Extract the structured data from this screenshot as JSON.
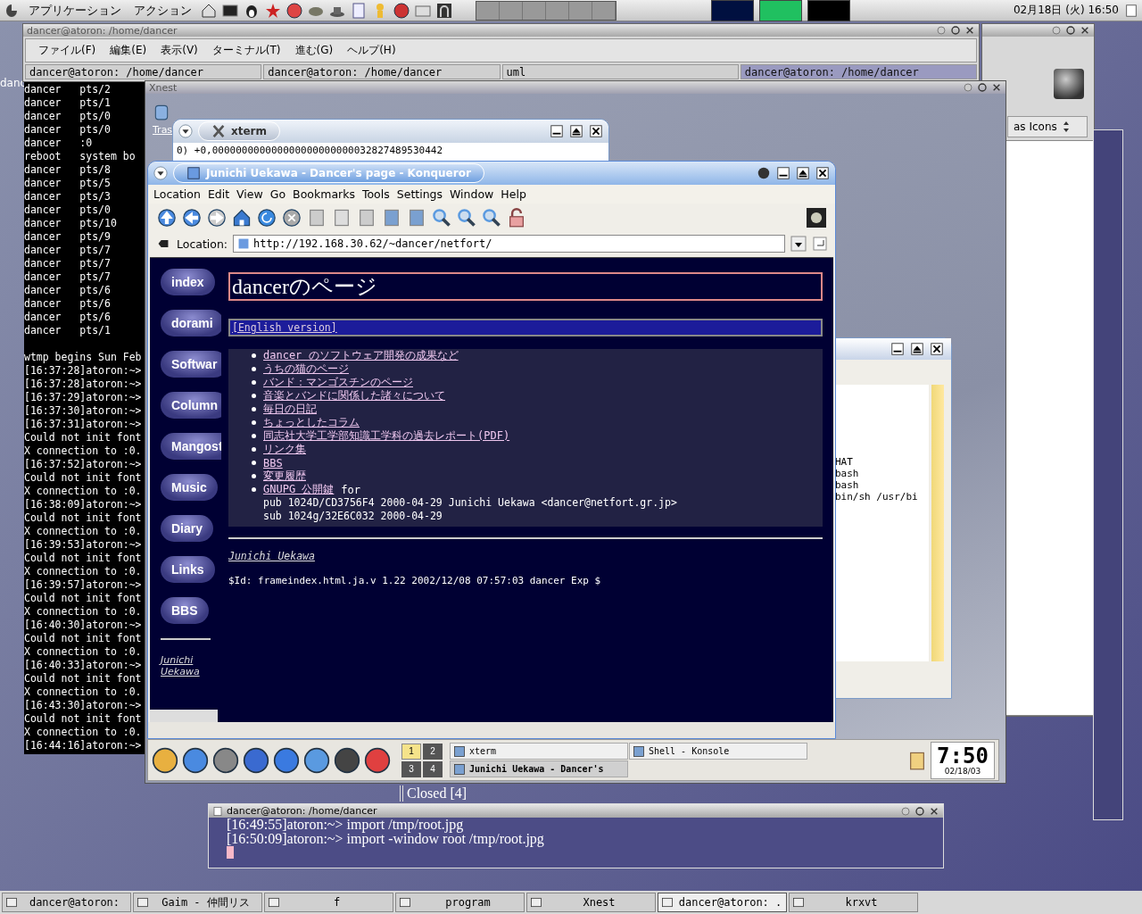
{
  "desktop_fragment": "danc",
  "top_panel": {
    "menus": [
      "アプリケーション",
      "アクション"
    ],
    "clock": "02月18日 (火) 16:50"
  },
  "konsole": {
    "title": "dancer@atoron: /home/dancer",
    "menus": [
      "ファイル(F)",
      "編集(E)",
      "表示(V)",
      "ターミナル(T)",
      "進む(G)",
      "ヘルプ(H)"
    ],
    "tabs": [
      {
        "label": "dancer@atoron: /home/dancer",
        "selected": false
      },
      {
        "label": "dancer@atoron: /home/dancer",
        "selected": false
      },
      {
        "label": "uml",
        "selected": false
      },
      {
        "label": "dancer@atoron: /home/dancer",
        "selected": true
      }
    ],
    "sessions": [
      "dancer   pts/2",
      "dancer   pts/1",
      "dancer   pts/0",
      "dancer   pts/0",
      "dancer   :0",
      "reboot   system bo",
      "dancer   pts/8",
      "dancer   pts/5",
      "dancer   pts/3",
      "dancer   pts/0",
      "dancer   pts/10",
      "dancer   pts/9",
      "dancer   pts/7",
      "dancer   pts/7",
      "dancer   pts/7",
      "dancer   pts/6",
      "dancer   pts/6",
      "dancer   pts/6",
      "dancer   pts/1"
    ],
    "log": [
      "wtmp begins Sun Feb",
      "[16:37:28]atoron:~>",
      "[16:37:28]atoron:~>",
      "[16:37:29]atoron:~>",
      "[16:37:30]atoron:~>",
      "[16:37:31]atoron:~>",
      "Could not init font",
      "X connection to :0.",
      "[16:37:52]atoron:~>",
      "Could not init font",
      "X connection to :0.",
      "[16:38:09]atoron:~>",
      "Could not init font",
      "X connection to :0.",
      "[16:39:53]atoron:~>",
      "Could not init font",
      "X connection to :0.",
      "[16:39:57]atoron:~>",
      "Could not init font",
      "X connection to :0.",
      "[16:40:30]atoron:~>",
      "Could not init font",
      "X connection to :0.",
      "[16:40:33]atoron:~>",
      "Could not init font",
      "X connection to :0.",
      "[16:43:30]atoron:~>",
      "Could not init font",
      "X connection to :0.",
      "[16:44:16]atoron:~>"
    ]
  },
  "file_manager": {
    "view_mode": "as Icons"
  },
  "xnest": {
    "title": "Xnest",
    "trash_label": "Tras"
  },
  "xterm": {
    "title": "xterm",
    "lines": [
      "0) +0,000000000000000000000000032827489530442"
    ]
  },
  "konqueror": {
    "title": "Junichi Uekawa - Dancer's page - Konqueror",
    "menus": [
      "Location",
      "Edit",
      "View",
      "Go",
      "Bookmarks",
      "Tools",
      "Settings",
      "Window",
      "Help"
    ],
    "location_label": "Location:",
    "url": "http://192.168.30.62/~dancer/netfort/",
    "nav_buttons": [
      "index",
      "dorami",
      "Softwar",
      "Column",
      "Mangost",
      "Music",
      "Diary",
      "Links",
      "BBS"
    ],
    "sidebar_author": "Junichi Uekawa",
    "heading": "dancerのページ",
    "english_link": "[English version]",
    "links": [
      "dancer のソフトウェア開発の成果など",
      "うちの猫のページ",
      "バンド：マンゴスチンのページ",
      "音楽とバンドに関係した諸々について",
      "毎日の日記",
      "ちょっとしたコラム",
      "同志社大学工学部知識工学科の過去レポート(PDF)",
      "リンク集",
      "BBS",
      "変更履歴"
    ],
    "gnupg": {
      "link": "GNUPG 公開鍵",
      "text": "for"
    },
    "key_lines": [
      "pub 1024D/CD3756F4 2000-04-29 Junichi Uekawa <dancer@netfort.gr.jp>",
      "sub 1024g/32E6C032 2000-04-29"
    ],
    "author": "Junichi Uekawa",
    "id_line": "$Id: frameindex.html.ja.v 1.22 2002/12/08 07:57:03 dancer Exp $"
  },
  "side_terminal": {
    "lines": [
      "HAT",
      "bash",
      "bash",
      "bin/sh /usr/bi"
    ]
  },
  "kde_panel": {
    "pager": [
      {
        "label": "1",
        "selected": true
      },
      {
        "label": "2",
        "selected": false
      },
      {
        "label": "3",
        "selected": false
      },
      {
        "label": "4",
        "selected": false
      }
    ],
    "tasks": [
      {
        "label": "xterm",
        "selected": false
      },
      {
        "label": "Shell - Konsole",
        "selected": false
      },
      {
        "label": "Junichi Uekawa - Dancer's",
        "selected": true
      }
    ],
    "clock": "7:50",
    "date": "02/18/03"
  },
  "behind_text": "Closed [4]",
  "small_terminal": {
    "title": "dancer@atoron: /home/dancer",
    "lines": [
      "[16:49:55]atoron:~> import /tmp/root.jpg",
      "[16:50:09]atoron:~> import -window root /tmp/root.jpg"
    ]
  },
  "bottom_taskbar": [
    {
      "label": "dancer@atoron:",
      "selected": false
    },
    {
      "label": "Gaim - 仲間リス",
      "selected": false
    },
    {
      "label": "f",
      "selected": false
    },
    {
      "label": "program",
      "selected": false
    },
    {
      "label": "Xnest",
      "selected": false
    },
    {
      "label": "dancer@atoron: .",
      "selected": true
    },
    {
      "label": "krxvt",
      "selected": false
    }
  ]
}
